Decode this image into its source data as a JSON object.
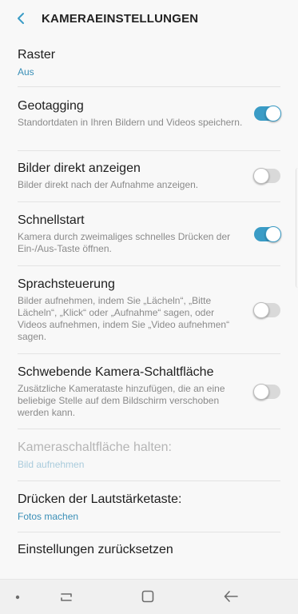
{
  "header": {
    "title": "KAMERAEINSTELLUNGEN",
    "back_icon": "chevron-left-icon",
    "accent": "#3a9cc6"
  },
  "items": [
    {
      "title": "Raster",
      "value": "Aus"
    },
    {
      "title": "Geotagging",
      "sub": "Standortdaten in Ihren Bildern und Videos speichern.",
      "toggle": "on"
    },
    {
      "title": "Bilder direkt anzeigen",
      "sub": "Bilder direkt nach der Aufnahme anzeigen.",
      "toggle": "off"
    },
    {
      "title": "Schnellstart",
      "sub": "Kamera durch zweimaliges schnelles Drücken der Ein-/Aus-Taste öffnen.",
      "toggle": "on"
    },
    {
      "title": "Sprachsteuerung",
      "sub": "Bilder aufnehmen, indem Sie „Lächeln“, „Bitte Lächeln“, „Klick“ oder „Aufnahme“ sagen, oder Videos aufnehmen, indem Sie „Video aufnehmen“ sagen.",
      "toggle": "off"
    },
    {
      "title": "Schwebende Kamera-Schaltfläche",
      "sub": "Zusätzliche Kamerataste hinzufügen, die an eine beliebige Stelle auf dem Bildschirm verschoben werden kann.",
      "toggle": "off"
    },
    {
      "title": "Kameraschaltfläche halten:",
      "value": "Bild aufnehmen",
      "disabled": true
    },
    {
      "title": "Drücken der Lautstärketaste:",
      "value": "Fotos machen"
    },
    {
      "title": "Einstellungen zurücksetzen"
    }
  ],
  "navbar": {
    "icons": [
      "dot-icon",
      "recent-apps-icon",
      "home-icon",
      "back-arrow-icon"
    ]
  }
}
